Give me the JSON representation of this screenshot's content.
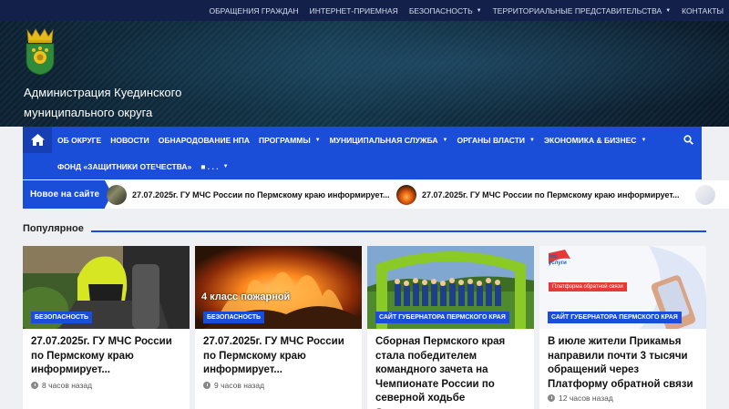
{
  "topnav": {
    "items": [
      {
        "label": "ОБРАЩЕНИЯ ГРАЖДАН",
        "dropdown": false
      },
      {
        "label": "ИНТЕРНЕТ-ПРИЕМНАЯ",
        "dropdown": false
      },
      {
        "label": "БЕЗОПАСНОСТЬ",
        "dropdown": true
      },
      {
        "label": "ТЕРРИТОРИАЛЬНЫЕ ПРЕДСТАВИТЕЛЬСТВА",
        "dropdown": true
      },
      {
        "label": "КОНТАКТЫ",
        "dropdown": false
      }
    ]
  },
  "header": {
    "title_line1": "Администрация Куединского",
    "title_line2": "муниципального округа",
    "logo_icon": "coat-of-arms-icon"
  },
  "mainnav": {
    "home_icon": "home-icon",
    "search_icon": "search-icon",
    "row1": [
      {
        "label": "ОБ ОКРУГЕ",
        "dropdown": false
      },
      {
        "label": "НОВОСТИ",
        "dropdown": false
      },
      {
        "label": "ОБНАРОДОВАНИЕ НПА",
        "dropdown": false
      },
      {
        "label": "ПРОГРАММЫ",
        "dropdown": true
      },
      {
        "label": "МУНИЦИПАЛЬНАЯ СЛУЖБА",
        "dropdown": true
      },
      {
        "label": "ОРГАНЫ ВЛАСТИ",
        "dropdown": true
      },
      {
        "label": "ЭКОНОМИКА & БИЗНЕС",
        "dropdown": true
      }
    ],
    "row2": [
      {
        "label": "ФОНД «ЗАЩИТНИКИ ОТЕЧЕСТВА»",
        "dropdown": false
      },
      {
        "label": "■ . . .",
        "dropdown": true
      }
    ]
  },
  "ticker": {
    "label": "Новое на сайте",
    "items": [
      "27.07.2025г. ГУ МЧС России по Пермскому краю информирует...",
      "27.07.2025г. ГУ МЧС России по Пермскому краю информирует..."
    ]
  },
  "popular": {
    "heading": "Популярное",
    "cards": [
      {
        "badge": "БЕЗОПАСНОСТЬ",
        "title": "27.07.2025г. ГУ МЧС России по Пермскому краю информирует...",
        "time": "8 часов назад"
      },
      {
        "badge": "БЕЗОПАСНОСТЬ",
        "title": "27.07.2025г. ГУ МЧС России по Пермскому краю информирует...",
        "time": "9 часов назад",
        "image_text": "4 класс пожарной"
      },
      {
        "badge": "САЙТ ГУБЕРНАТОРА ПЕРМСКОГО КРАЯ",
        "title": "Сборная Пермского края стала победителем командного зачета на Чемпионате России по северной ходьбе",
        "time": ""
      },
      {
        "badge": "САЙТ ГУБЕРНАТОРА ПЕРМСКОГО КРАЯ",
        "title": "В июле жители Прикамья направили почти 3 тысячи обращений через Платформу обратной связи",
        "time": "12 часов назад",
        "image_text_logo": "гос услуги",
        "image_text_banner": "Платформа обратной связи"
      }
    ]
  },
  "colors": {
    "brand_blue": "#1a4ed8",
    "topbar": "#13204a",
    "page_bg": "#eef0f4"
  }
}
